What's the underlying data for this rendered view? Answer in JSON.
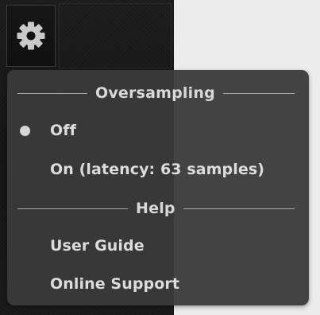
{
  "settings_button": {
    "icon": "gear-icon"
  },
  "menu": {
    "sections": [
      {
        "title": "Oversampling",
        "items": [
          {
            "label": "Off",
            "selected": true
          },
          {
            "label": "On (latency: 63 samples)",
            "selected": false
          }
        ]
      },
      {
        "title": "Help",
        "items": [
          {
            "label": "User Guide",
            "selected": false
          },
          {
            "label": "Online Support",
            "selected": false
          }
        ]
      }
    ]
  },
  "colors": {
    "menu_background": "#3a3a3a",
    "menu_text": "#dcdcdc",
    "rule": "#a9a9a9",
    "plugin_background": "#171717",
    "window_background": "#ececec"
  }
}
